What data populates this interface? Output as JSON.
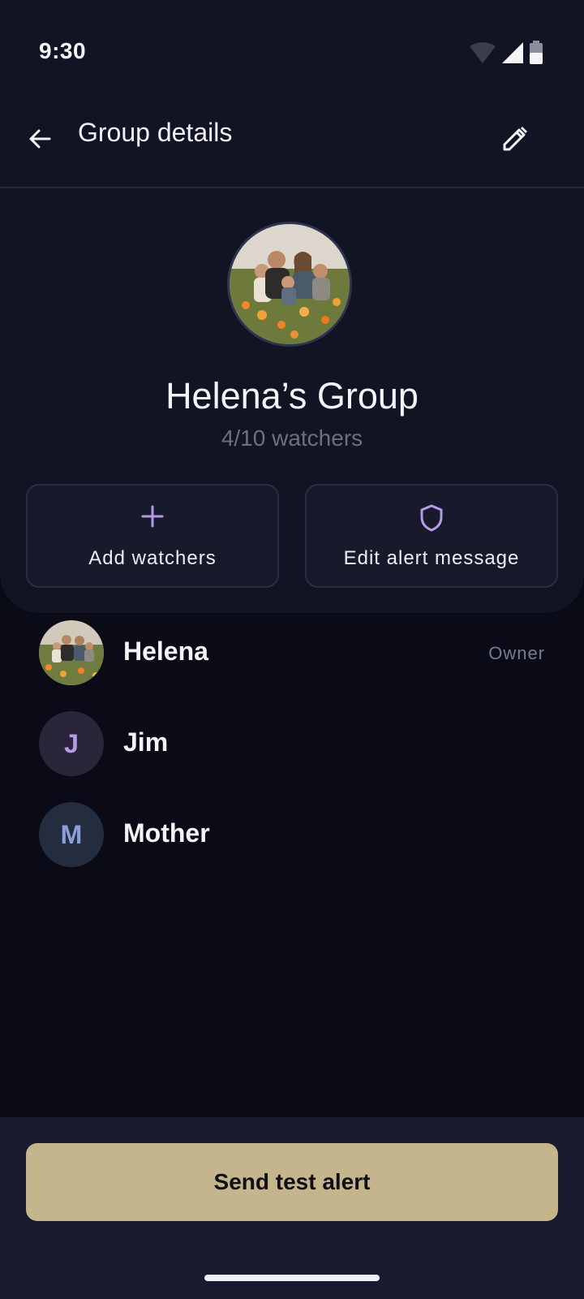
{
  "status_bar": {
    "time": "9:30"
  },
  "toolbar": {
    "title": "Group details"
  },
  "group": {
    "name": "Helena’s Group",
    "count": "4/10 watchers"
  },
  "actions": {
    "add_watchers": "Add watchers",
    "edit_alert_message": "Edit alert message"
  },
  "members": [
    {
      "name": "Helena",
      "role": "Owner",
      "avatar": "photo"
    },
    {
      "name": "Jim",
      "initial": "J"
    },
    {
      "name": "Mother",
      "initial": "M"
    }
  ],
  "bottom": {
    "button_label": "Send test alert"
  },
  "colors": {
    "accent_purple": "#b59be6",
    "primary_button": "#c5b58d",
    "background": "#0a0b16"
  },
  "icons": [
    "wifi-icon",
    "signal-icon",
    "battery-icon",
    "back-arrow-icon",
    "pencil-icon",
    "plus-icon",
    "shield-icon"
  ]
}
